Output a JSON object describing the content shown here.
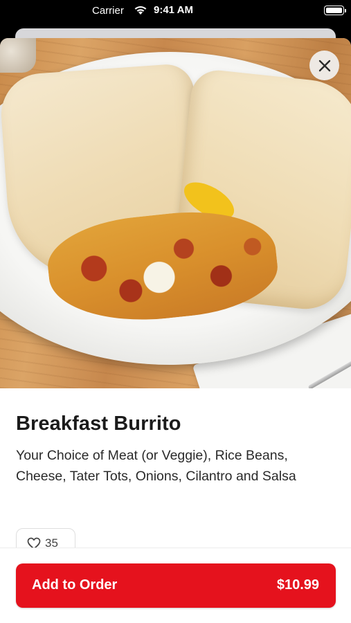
{
  "status_bar": {
    "carrier": "Carrier",
    "time": "9:41 AM",
    "wifi_icon": "wifi-icon",
    "battery_icon": "battery-icon"
  },
  "item": {
    "image_icon": "burrito-photo",
    "title": "Breakfast Burrito",
    "description": "Your Choice of Meat (or Veggie), Rice Beans, Cheese, Tater Tots, Onions, Cilantro and Salsa",
    "likes": "35",
    "like_icon": "heart-icon"
  },
  "actions": {
    "close_icon": "close-icon",
    "add_to_order_label": "Add to Order",
    "price": "$10.99"
  },
  "colors": {
    "accent": "#e5121d",
    "text": "#1b1b1b"
  }
}
